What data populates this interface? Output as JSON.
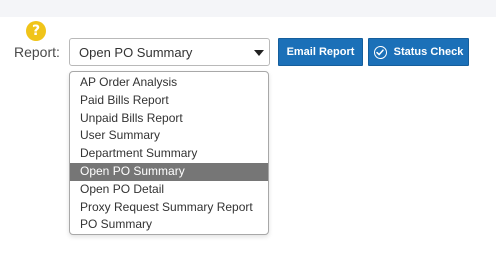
{
  "help": {
    "icon": "help-circle-icon",
    "glyph": "?"
  },
  "report": {
    "label": "Report:",
    "selected": "Open PO Summary",
    "options": [
      "AP Order Analysis",
      "Paid Bills Report",
      "Unpaid Bills Report",
      "User Summary",
      "Department Summary",
      "Open PO Summary",
      "Open PO Detail",
      "Proxy Request Summary Report",
      "PO Summary"
    ],
    "selected_index": 5
  },
  "buttons": {
    "email_report": "Email Report",
    "status_check": "Status Check",
    "status_check_icon": "check-circle-icon"
  },
  "colors": {
    "accent": "#1b70b8",
    "help_icon": "#f0c419",
    "selected_row": "#767676"
  }
}
